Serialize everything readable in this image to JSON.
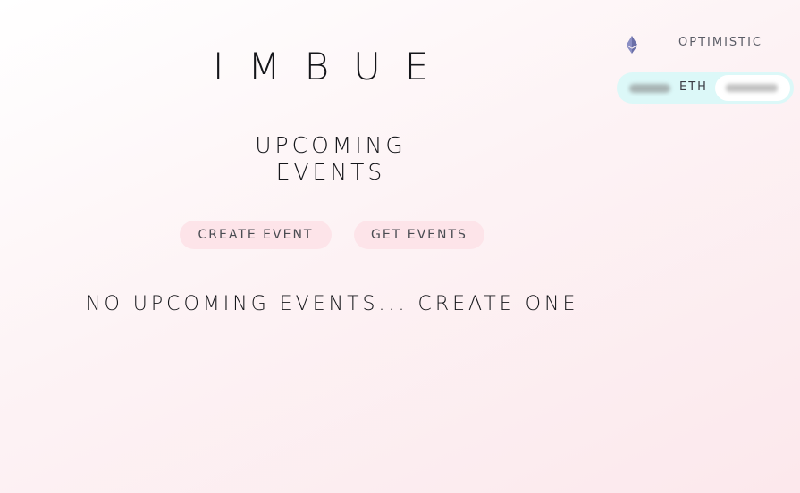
{
  "header": {
    "logo": "IMBUE"
  },
  "network": {
    "icon": "ethereum-icon",
    "name": "OPTIMISTIC"
  },
  "wallet": {
    "token": "ETH"
  },
  "main": {
    "title_line1": "UPCOMING",
    "title_line2": "EVENTS",
    "buttons": {
      "create": "CREATE EVENT",
      "get": "GET EVENTS"
    },
    "empty_message": "NO UPCOMING EVENTS... CREATE ONE"
  },
  "colors": {
    "button_bg": "#fde4e9",
    "wallet_bg": "#dcf8f8",
    "accent_icon": "#6b6fa8"
  }
}
